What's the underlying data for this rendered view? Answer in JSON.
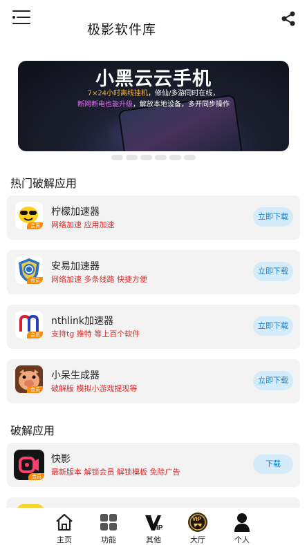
{
  "header": {
    "title": "极影软件库",
    "menu_icon": "menu-icon",
    "share_icon": "share-icon"
  },
  "banner": {
    "title": "小黑云云手机",
    "line1_highlight": "7×24小时离线挂机",
    "line1_rest": "，修仙/多游同时在线，",
    "line2_highlight": "断网断电也能升级",
    "line2_rest": "，解放本地设备，多开同步操作"
  },
  "sections": {
    "hot_title": "热门破解应用",
    "crack_title": "破解应用"
  },
  "hot_apps": [
    {
      "name": "柠檬加速器",
      "desc": "网络加速 应用加速",
      "badge": "会员",
      "button": "立即下载",
      "icon": "lemon-accelerator-icon"
    },
    {
      "name": "安易加速器",
      "desc": "网络加速 多条线路 快捷方便",
      "badge": "会员",
      "button": "立即下载",
      "icon": "anyi-shield-icon"
    },
    {
      "name": "nthlink加速器",
      "desc": "支持tg 推特 等上百个软件",
      "badge": "会员",
      "button": "立即下载",
      "icon": "nthlink-icon"
    },
    {
      "name": "小呆生成器",
      "desc": "破解版 模拟小游戏提现等",
      "badge": "会员",
      "button": "立即下载",
      "icon": "xiaodai-pig-icon"
    }
  ],
  "crack_apps": [
    {
      "name": "快影",
      "desc": "最新版本 解锁会员 解锁模板 免除广告",
      "badge": "会员",
      "button": "下载",
      "icon": "kuaiying-icon"
    }
  ],
  "tabbar": [
    {
      "label": "主页",
      "icon": "home-icon"
    },
    {
      "label": "功能",
      "icon": "grid-icon"
    },
    {
      "label": "其他",
      "icon": "vip-letter-icon"
    },
    {
      "label": "大厅",
      "icon": "vip-medal-icon"
    },
    {
      "label": "个人",
      "icon": "person-icon"
    }
  ],
  "colors": {
    "accent_red": "#e02a2a",
    "button_bg": "#d4ebf9",
    "button_text": "#1a7fc1",
    "badge": "#ff8a00",
    "card_bg": "#f3f3f3"
  }
}
